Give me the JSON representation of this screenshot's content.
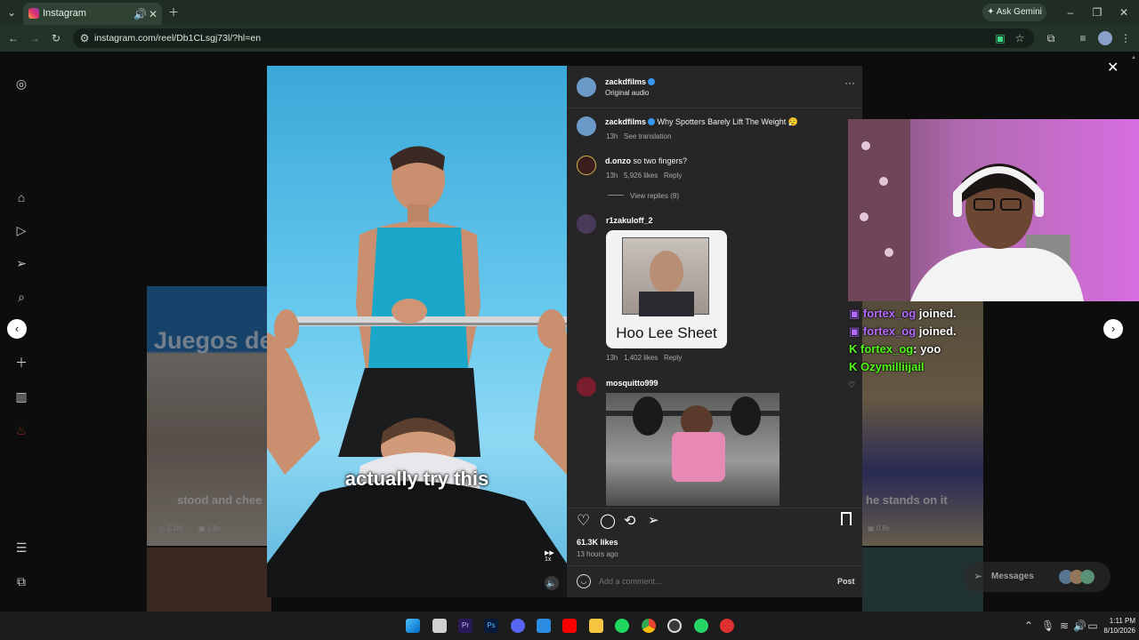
{
  "browser": {
    "tab_title": "Instagram",
    "url": "instagram.com/reel/Db1CLsgj73l/?hl=en",
    "ask_gemini": "Ask Gemini"
  },
  "reel": {
    "caption_overlay": "actually try this",
    "speed_badge": "1x"
  },
  "post": {
    "author": "zackdfilms",
    "audio": "Original audio",
    "caption_author": "zackdfilms",
    "caption_text": "Why Spotters Barely Lift The Weight 😮‍💨",
    "caption_time": "13h",
    "see_translation": "See translation",
    "comments": [
      {
        "user": "d.onzo",
        "text": "so two fingers?",
        "time": "13h",
        "likes": "5,926 likes",
        "reply": "Reply",
        "view_replies": "View replies (8)"
      },
      {
        "user": "r1zakuloff_2",
        "sticker_text": "Hoo Lee Sheet",
        "time": "13h",
        "likes": "1,402 likes",
        "reply": "Reply"
      },
      {
        "user": "mosquitto999",
        "gif_label": "pink weightlifter gif"
      }
    ],
    "likes_count": "61.3K likes",
    "posted_ago": "13 hours ago",
    "comment_placeholder": "Add a comment...",
    "post_button": "Post"
  },
  "background_reels": {
    "left_caption": "stood and chee",
    "left_views": "2.1M",
    "left_speed": "1.8x",
    "left_banner": "Juegos de l",
    "right_caption": "he stands on it",
    "right_speed": "0.8x"
  },
  "stream_overlay": {
    "chat": [
      {
        "user": "fortex_og",
        "text": "joined.",
        "color": "#b46cff"
      },
      {
        "user": "fortex_og",
        "text": "joined.",
        "color": "#b46cff"
      },
      {
        "user": "fortex_og",
        "text": ": yoo",
        "color": "#53fc18"
      },
      {
        "user": "Ozymilliijail",
        "text": "",
        "color": "#53fc18"
      }
    ]
  },
  "messages_widget": {
    "label": "Messages"
  },
  "taskbar": {
    "time": "1:11 PM",
    "date": "8/10/2026"
  },
  "colors": {
    "accent": "#3897f0",
    "tabbar": "#1f2d24",
    "panel": "#262626"
  }
}
